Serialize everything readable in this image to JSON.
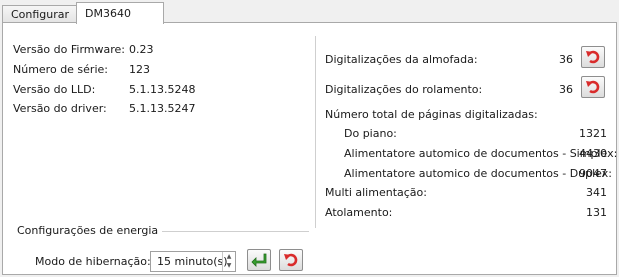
{
  "tabs": [
    {
      "label": "Configurar",
      "active": false
    },
    {
      "label": "DM3640",
      "active": true
    }
  ],
  "info": {
    "firmware_label": "Versão do Firmware:",
    "firmware_value": "0.23",
    "serial_label": "Número de série:",
    "serial_value": "123",
    "lld_label": "Versão do LLD:",
    "lld_value": "5.1.13.5248",
    "driver_label": "Versão do driver:",
    "driver_value": "5.1.13.5247"
  },
  "energy": {
    "group_title": "Configurações de energia",
    "hibernate_label": "Modo de hibernação:",
    "hibernate_value": "15 minuto(s)"
  },
  "counters": {
    "pad_label": "Digitalizações da almofada:",
    "pad_value": "36",
    "roller_label": "Digitalizações do rolamento:",
    "roller_value": "36",
    "total_label": "Número total de páginas digitalizadas:",
    "flatbed_label": "Do piano:",
    "flatbed_value": "1321",
    "adf_simplex_label": "Alimentatore automico de documentos - Simplex:",
    "adf_simplex_value": "4430",
    "adf_duplex_label": "Alimentatore automico de documentos - Duplex:",
    "adf_duplex_value": "9047",
    "multifeed_label": "Multi alimentação:",
    "multifeed_value": "341",
    "jam_label": "Atolamento:",
    "jam_value": "131"
  },
  "colors": {
    "reset_icon": "#d92b2b",
    "apply_icon": "#3aa032"
  },
  "icons": {
    "reset": "reset-arrow-icon",
    "apply": "green-enter-arrow-icon"
  }
}
